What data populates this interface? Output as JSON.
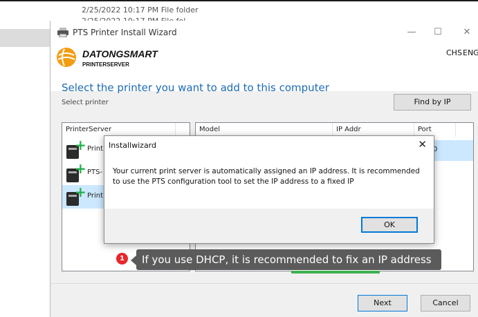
{
  "background": {
    "row1": "2/25/2022 10:17 PM    File folder",
    "row2": "2/25/2022 10:17 PM    File fol"
  },
  "window": {
    "title": "PTS Printer Install Wizard",
    "controls": {
      "minimize": "—",
      "maximize": "☐",
      "close": "✕"
    }
  },
  "brand": {
    "name": "DATONGSMART",
    "subtitle": "PRINTERSERVER"
  },
  "language": {
    "chs": "CHS",
    "eng": "ENG"
  },
  "main": {
    "headline": "Select the printer you want to add to this computer",
    "subheadline": "Select printer",
    "find_by_ip": "Find by IP"
  },
  "printer_servers": {
    "header": "PrinterServer",
    "items": [
      {
        "label": "Print"
      },
      {
        "label": "PTS-"
      },
      {
        "label": "Print"
      }
    ]
  },
  "printers_table": {
    "columns": [
      "Model",
      "IP Addr",
      "Port"
    ],
    "selected_row_port_fragment": "0"
  },
  "footer": {
    "next": "Next",
    "cancel": "Cancel"
  },
  "dialog": {
    "title": "Installwizard",
    "close": "✕",
    "message": "Your current print server is automatically assigned an IP address. It is recommended to use the PTS configuration tool to set the IP address to a fixed IP",
    "ok": "OK"
  },
  "annotation": {
    "number": "1",
    "text": "If you use DHCP, it is recommended to fix an IP address"
  },
  "colors": {
    "accent": "#1c6bb5",
    "selection": "#cce8ff",
    "badge": "#e8262b",
    "tooltip": "#5b5b5b",
    "plus": "#22b24a"
  }
}
